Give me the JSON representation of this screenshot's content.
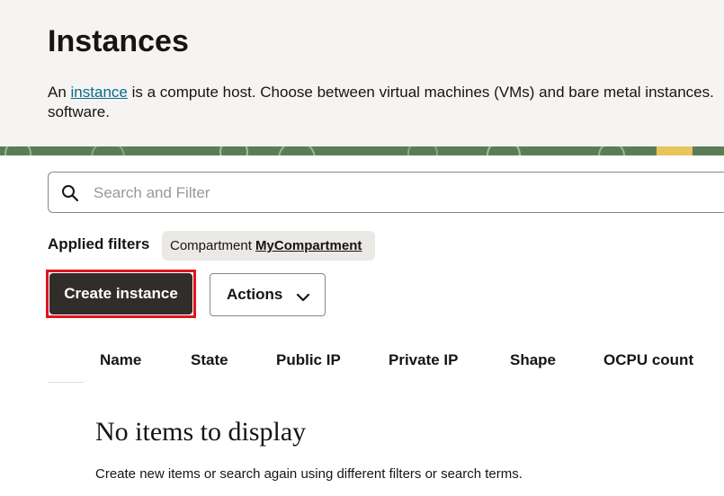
{
  "page": {
    "title": "Instances",
    "intro_prefix": "An ",
    "intro_link": "instance",
    "intro_suffix": " is a compute host. Choose between virtual machines (VMs) and bare metal instances.",
    "intro_line2": "software."
  },
  "search": {
    "placeholder": "Search and Filter",
    "icon": "search-icon"
  },
  "filters": {
    "label": "Applied filters",
    "chip_key": "Compartment",
    "chip_value": "MyCompartment"
  },
  "toolbar": {
    "create_label": "Create instance",
    "actions_label": "Actions",
    "actions_icon": "chevron-down-icon"
  },
  "table": {
    "columns": [
      "Name",
      "State",
      "Public IP",
      "Private IP",
      "Shape",
      "OCPU count"
    ]
  },
  "empty_state": {
    "title": "No items to display",
    "message": "Create new items or search again using different filters or search terms."
  },
  "colors": {
    "header_bg": "#f5f4f2",
    "primary_button": "#312d2a",
    "highlight": "#e0141c",
    "link": "#0a6b8a"
  }
}
